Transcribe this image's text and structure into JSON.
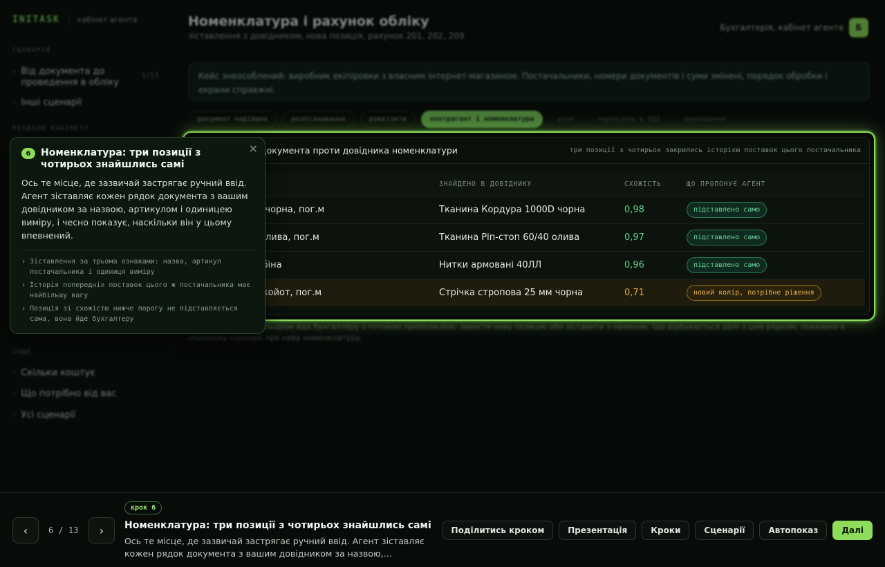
{
  "brand": {
    "logo": "INITASK",
    "subtitle": "кабінет агента"
  },
  "sidebar": {
    "section_scenario": "СЦЕНАРІЙ",
    "scenario_items": [
      {
        "label": "Від документа до проведення в обліку",
        "count": "1/13"
      },
      {
        "label": "Інші сценарії"
      }
    ],
    "section_cabinet": "РОЗДІЛИ КАБІНЕТУ",
    "section_other": "ІНШЕ",
    "other_items": [
      {
        "label": "Скільки коштує"
      },
      {
        "label": "Що потрібно від вас"
      },
      {
        "label": "Усі сценарії"
      }
    ]
  },
  "header": {
    "title": "Номенклатура і рахунок обліку",
    "subtitle": "зіставлення з довідником, нова позиція, рахунок 201, 202, 209",
    "user_label": "Бухгалтерія, кабінет агента",
    "user_badge": "Б"
  },
  "case_note": "Кейс знеособлений: виробник екіпіровки з власним інтернет-магазином. Постачальники, номери документів і суми змінені, порядок обробки і екрани справжні.",
  "tabs": [
    {
      "label": "документ надійшов",
      "state": "done"
    },
    {
      "label": "розпізнавання",
      "state": "done"
    },
    {
      "label": "реквізити",
      "state": "done"
    },
    {
      "label": "контрагент і номенклатура",
      "state": "active"
    },
    {
      "label": "ціни",
      "state": "upcoming"
    },
    {
      "label": "перевірка в ЄДІ",
      "state": "upcoming"
    },
    {
      "label": "проведення",
      "state": "upcoming"
    }
  ],
  "card": {
    "title": "документа проти довідника номенклатури",
    "meta": "три позиції з чотирьох закрились історією поставок цього постачальника",
    "columns": [
      "НТА",
      "ЗНАЙДЕНО В ДОВІДНИКУ",
      "СХОЖІСТЬ",
      "ЩО ПРОПОНУЄ АГЕНТ"
    ],
    "rows": [
      {
        "doc": "дура 1000D, чорна, пог.м",
        "found": "Тканина Кордура 1000D чорна",
        "score": "0,98",
        "action": "підставлено само",
        "warn": false
      },
      {
        "doc": "стоп 60/40, олива, пог.м",
        "found": "Тканина Ріп-стоп 60/40 олива",
        "score": "0,97",
        "action": "підставлено само",
        "warn": false
      },
      {
        "doc": "ані 40ЛЛ, бобіна",
        "found": "Нитки армовані 40ЛЛ",
        "score": "0,96",
        "action": "підставлено само",
        "warn": false
      },
      {
        "doc": "пова 25 мм, койот, пог.м",
        "found": "Стрічка стропова 25 мм чорна",
        "score": "0,71",
        "action": "новий колір, потрібне рішення",
        "warn": true
      }
    ]
  },
  "background_note": "Позиція з новим кольором йде бухгалтеру з готовою пропозицією: завести нову позицію або зіставити з наявною. Що відбувається далі з цим рядком, показано в окремому сценарії про нову номенклатуру.",
  "popover": {
    "step": "6",
    "title": "Номенклатура: три позиції з чотирьох знайшлись самі",
    "text": "Ось те місце, де зазвичай застрягає ручний ввід. Агент зіставляє кожен рядок документа з вашим довідником за назвою, артикулом і одиницею виміру, і чесно показує, наскільки він у цьому впевнений.",
    "bullets": [
      "Зіставлення за трьома ознаками: назва, артикул постачальника і одиниця виміру",
      "Історія попередніх поставок цього ж постачальника має найбільшу вагу",
      "Позиція зі схожістю нижче порогу не підставляється сама, вона йде бухгалтеру"
    ],
    "close": "×"
  },
  "bottom": {
    "prev": "‹",
    "next": "›",
    "counter": "6 / 13",
    "step_tag": "крок 6",
    "title": "Номенклатура: три позиції з чотирьох знайшлись самі",
    "text": "Ось те місце, де зазвичай застрягає ручний ввід. Агент зіставляє кожен рядок документа з вашим довідником за назвою,…",
    "actions": [
      "Поділитись кроком",
      "Презентація",
      "Кроки",
      "Сценарії",
      "Автопоказ"
    ],
    "primary": "Далі"
  },
  "colors": {
    "accent": "#8fdc5b",
    "ok": "#63d38e",
    "warn": "#e6a83a",
    "bg": "#060a07"
  }
}
